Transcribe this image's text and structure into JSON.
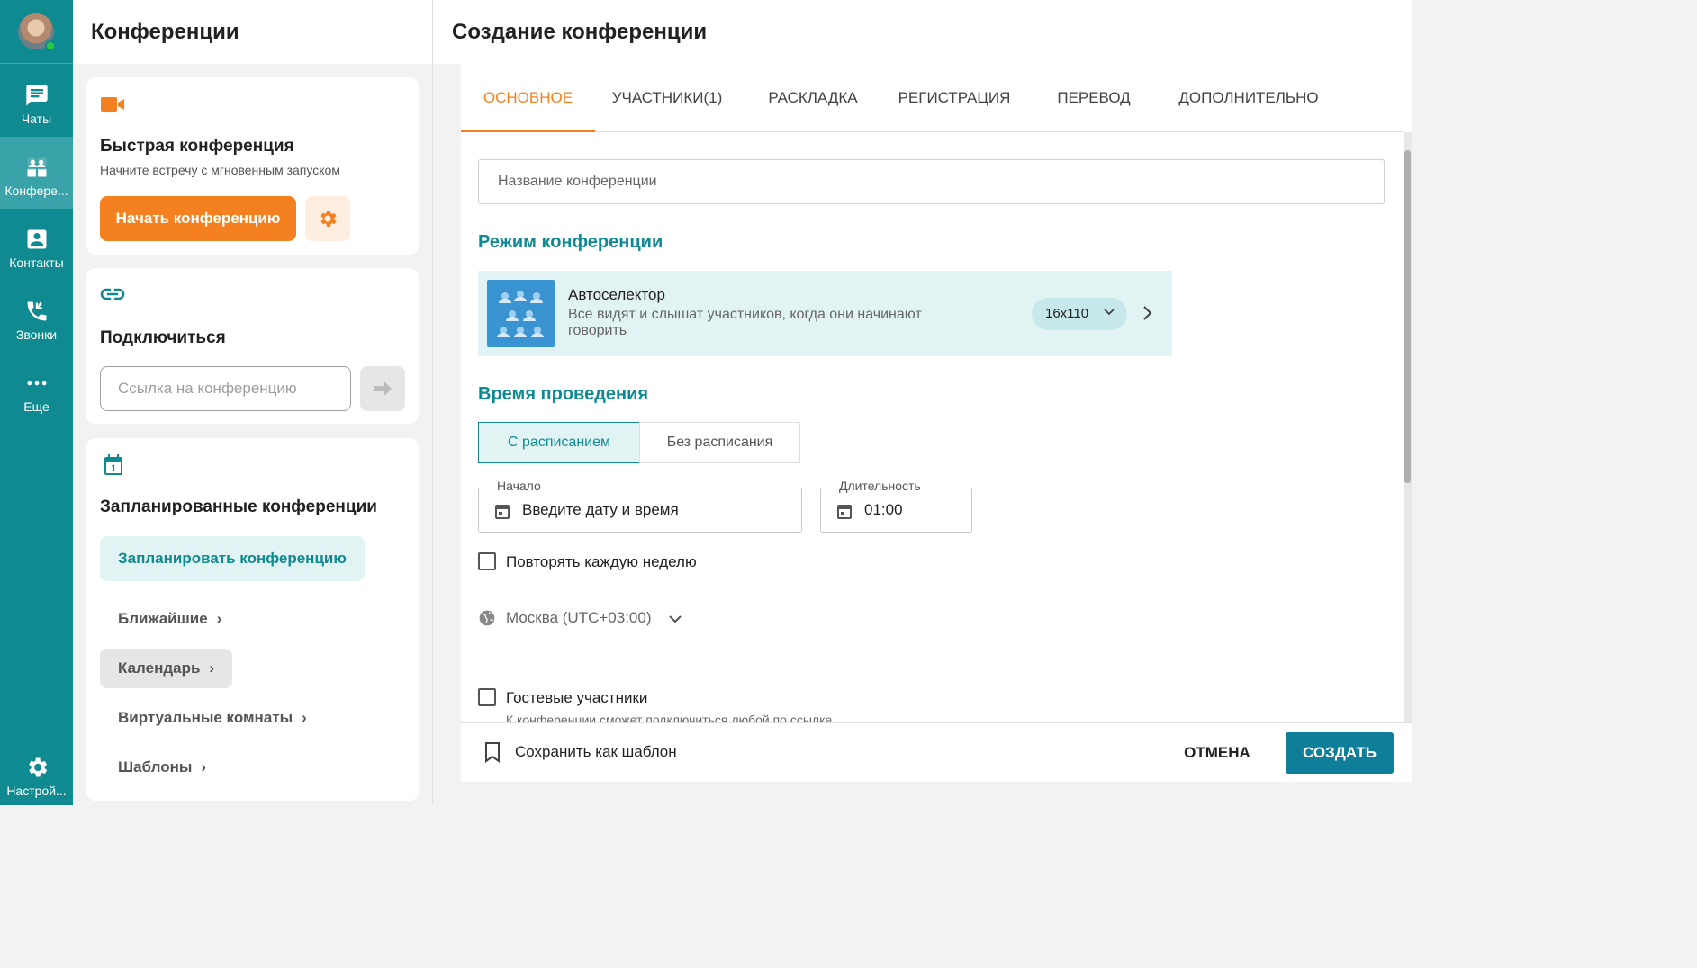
{
  "rail": {
    "items": [
      {
        "label": "Чаты",
        "icon": "chat-icon"
      },
      {
        "label": "Конфере...",
        "icon": "conference-icon"
      },
      {
        "label": "Контакты",
        "icon": "contacts-icon"
      },
      {
        "label": "Звонки",
        "icon": "phone-icon"
      },
      {
        "label": "Еще",
        "icon": "more-icon"
      }
    ],
    "settings_label": "Настрой..."
  },
  "mid": {
    "title": "Конференции",
    "quick": {
      "title": "Быстрая конференция",
      "subtitle": "Начните встречу с мгновенным запуском",
      "start_button": "Начать конференцию"
    },
    "connect": {
      "title": "Подключиться",
      "placeholder": "Ссылка на конференцию"
    },
    "scheduled": {
      "title": "Запланированные конференции",
      "plan_button": "Запланировать конференцию",
      "links": [
        "Ближайшие",
        "Календарь",
        "Виртуальные комнаты",
        "Шаблоны"
      ]
    }
  },
  "right": {
    "title": "Создание конференции",
    "tabs": [
      "ОСНОВНОЕ",
      "УЧАСТНИКИ(1)",
      "РАСКЛАДКА",
      "РЕГИСТРАЦИЯ",
      "ПЕРЕВОД",
      "ДОПОЛНИТЕЛЬНО"
    ],
    "name_placeholder": "Название конференции",
    "mode_section": "Режим конференции",
    "mode": {
      "title": "Автоселектор",
      "description": "Все видят и слышат участников, когда они начинают говорить",
      "size": "16x110"
    },
    "time_section": "Время проведения",
    "schedule_options": [
      "С расписанием",
      "Без расписания"
    ],
    "start": {
      "legend": "Начало",
      "value": "Введите дату и время"
    },
    "duration": {
      "legend": "Длительность",
      "value": "01:00"
    },
    "repeat_label": "Повторять каждую неделю",
    "timezone": "Москва (UTC+03:00)",
    "guests_label": "Гостевые участники",
    "guests_hint": "К конференции сможет подключиться любой по ссылке",
    "save_template": "Сохранить как шаблон",
    "cancel": "ОТМЕНА",
    "create": "СОЗДАТЬ"
  },
  "colors": {
    "teal": "#0f8a91",
    "orange": "#f5801f",
    "create_button": "#0f7f99"
  }
}
